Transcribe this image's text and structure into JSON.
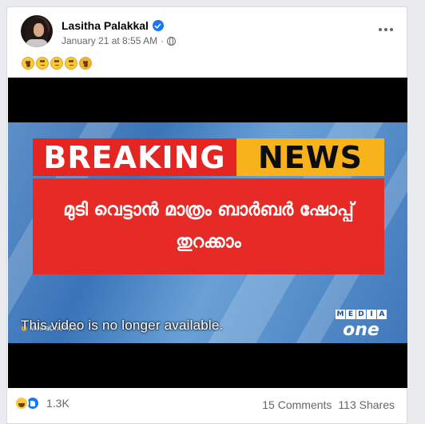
{
  "post": {
    "author": "Lasitha Palakkal",
    "timestamp": "January 21 at 8:55 AM",
    "separator": "·",
    "audience_icon": "globe-icon",
    "text_emojis": [
      "astonished",
      "face-with-rolling-eyes",
      "face-with-rolling-eyes",
      "face-with-rolling-eyes",
      "face-with-open-mouth-hand"
    ],
    "colors": {
      "verified": "#1877f2",
      "meta_text": "#65676b"
    }
  },
  "video": {
    "breaking_label": "BREAKING",
    "news_label": "NEWS",
    "headline_line1": "മുടി വെട്ടാൻ മാത്രം ബാർബർ ഷോപ്പ്",
    "headline_line2": "തുറക്കാം",
    "ticker_handle": "MediaOneTV.in",
    "unavailable_message": "This video is no longer available.",
    "logo_top": [
      "M",
      "E",
      "D",
      "I",
      "A"
    ],
    "logo_word": "one",
    "colors": {
      "breaking": "#e52521",
      "news": "#f7b21c"
    }
  },
  "footer": {
    "reaction_icons": [
      "haha-icon",
      "like-icon"
    ],
    "reaction_count": "1.3K",
    "comments": "15 Comments",
    "shares": "113 Shares"
  }
}
